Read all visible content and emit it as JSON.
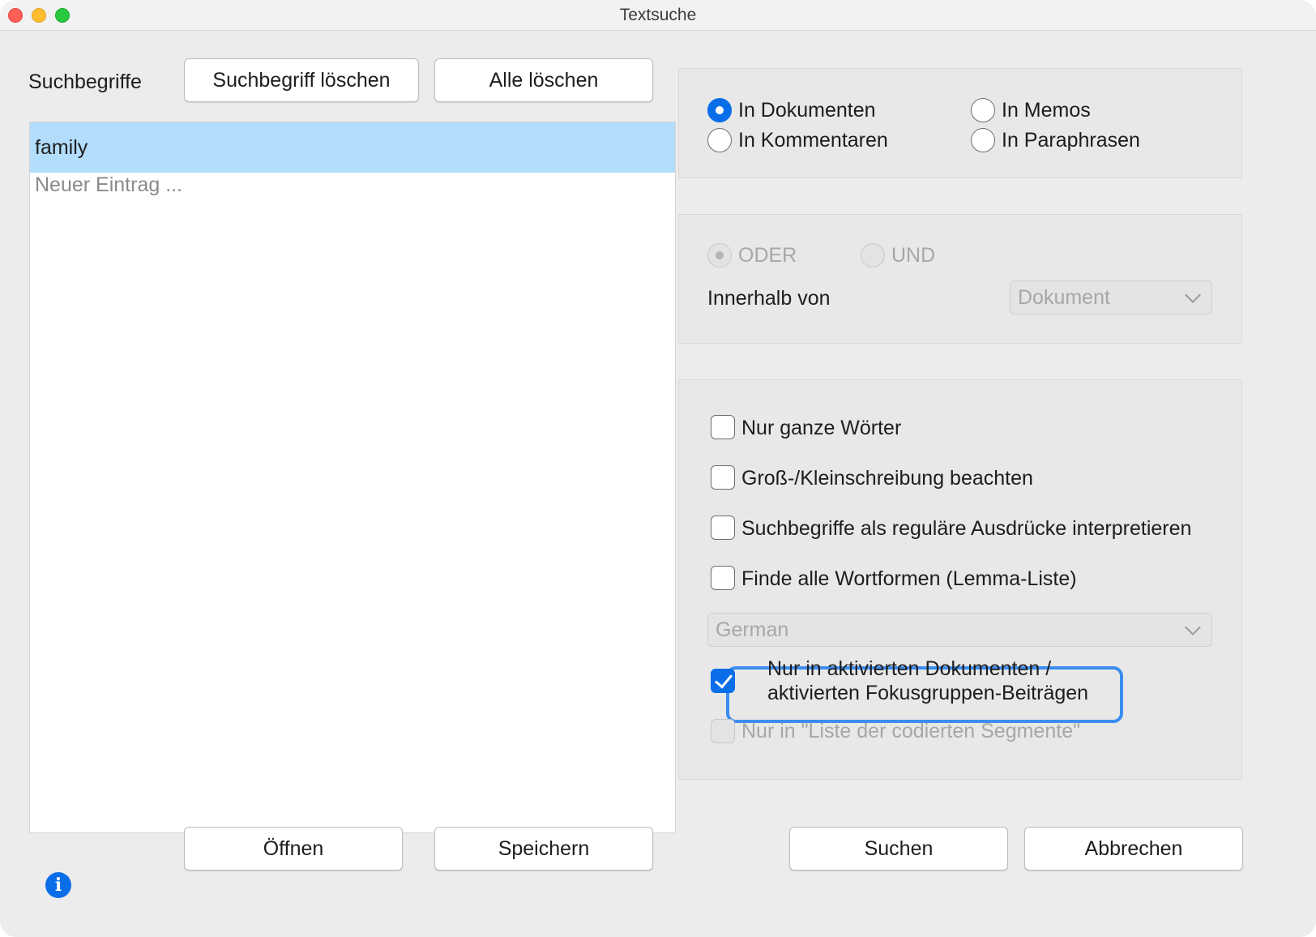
{
  "window": {
    "title": "Textsuche"
  },
  "terms": {
    "label": "Suchbegriffe",
    "delete_term_button": "Suchbegriff löschen",
    "delete_all_button": "Alle löschen",
    "items": [
      "family"
    ],
    "new_entry_placeholder": "Neuer Eintrag ..."
  },
  "scope": {
    "options": [
      {
        "label": "In Dokumenten",
        "selected": true
      },
      {
        "label": "In Memos",
        "selected": false
      },
      {
        "label": "In Kommentaren",
        "selected": false
      },
      {
        "label": "In Paraphrasen",
        "selected": false
      }
    ]
  },
  "logic": {
    "or_label": "ODER",
    "and_label": "UND",
    "selected": "ODER",
    "within_label": "Innerhalb von",
    "within_value": "Dokument"
  },
  "options": {
    "whole_words": "Nur ganze Wörter",
    "case_sensitive": "Groß-/Kleinschreibung beachten",
    "regex": "Suchbegriffe als reguläre Ausdrücke interpretieren",
    "lemma": "Finde alle Wortformen (Lemma-Liste)",
    "language_value": "German",
    "activated_docs": "Nur in aktivierten Dokumenten / aktivierten Fokusgruppen-Beiträgen",
    "activated_docs_checked": true,
    "coded_segments": "Nur in \"Liste der codierten Segmente\""
  },
  "footer": {
    "open_button": "Öffnen",
    "save_button": "Speichern",
    "search_button": "Suchen",
    "cancel_button": "Abbrechen"
  },
  "colors": {
    "accent": "#0a6ee8",
    "selection": "#b3ddfc"
  }
}
